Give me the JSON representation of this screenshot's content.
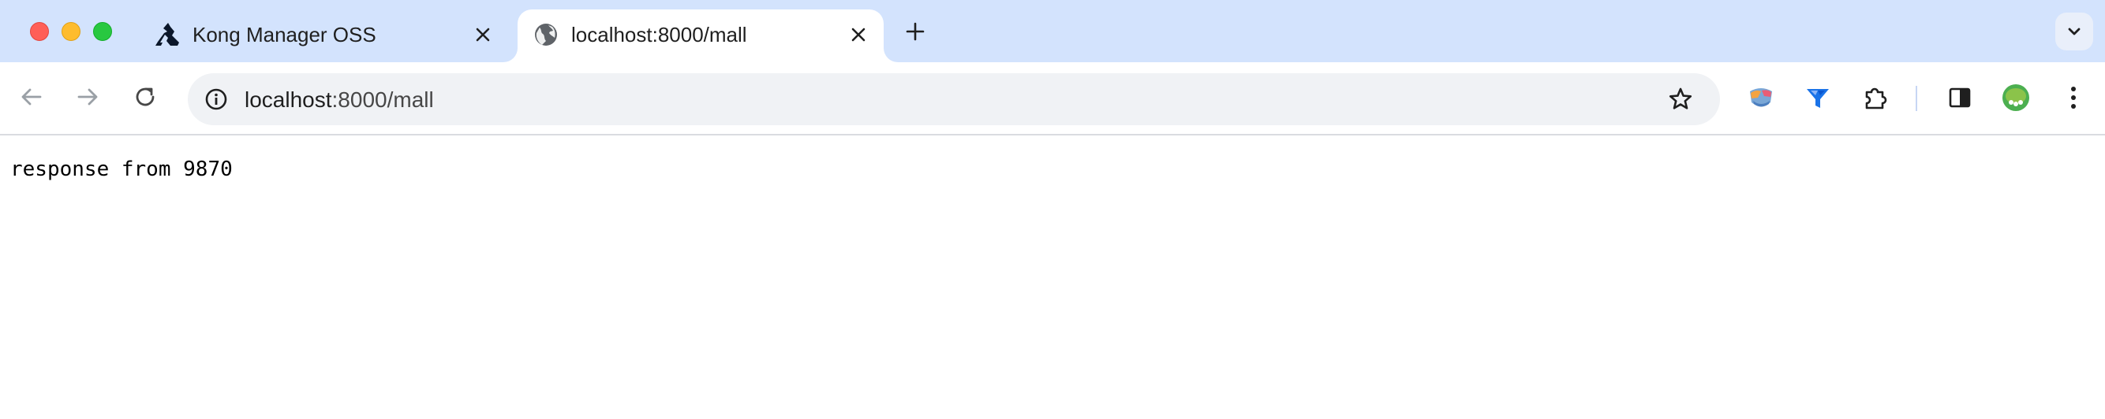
{
  "window": {
    "traffic_lights": [
      "close",
      "minimize",
      "zoom"
    ]
  },
  "tabs": [
    {
      "title": "Kong Manager OSS",
      "icon": "kong-logo-icon",
      "active": false
    },
    {
      "title": "localhost:8000/mall",
      "icon": "globe-icon",
      "active": true
    }
  ],
  "toolbar": {
    "url_host": "localhost",
    "url_rest": ":8000/mall",
    "extensions": [
      "colorful-globe-extension-icon",
      "blue-funnel-extension-icon",
      "puzzle-icon",
      "side-panel-icon",
      "profile-avatar-icon",
      "more-vert-icon"
    ]
  },
  "page": {
    "body_text": "response from 9870"
  },
  "colors": {
    "tabstrip_bg": "#d3e3fd",
    "omnibox_bg": "#f0f2f5",
    "icon_color": "#474747"
  }
}
